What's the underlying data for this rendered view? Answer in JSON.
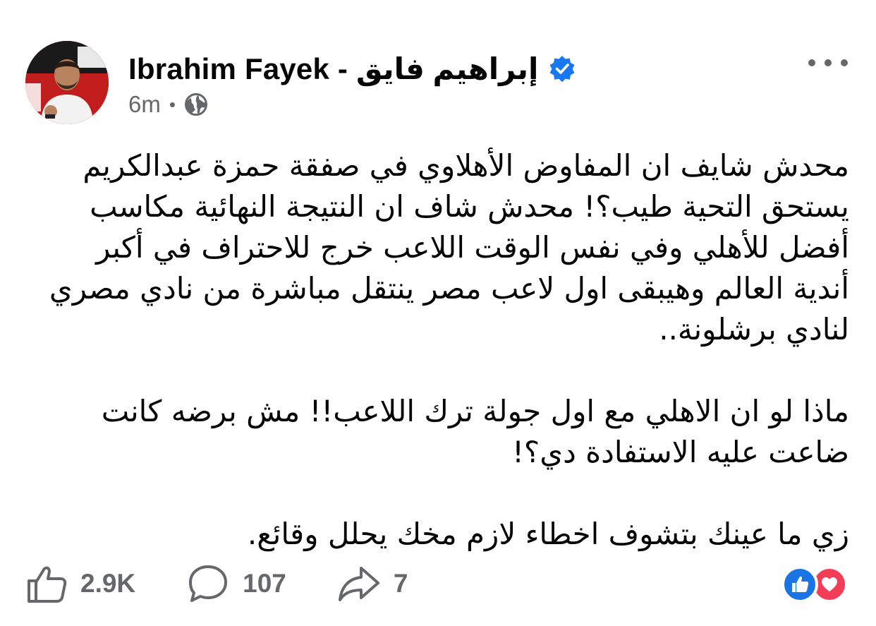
{
  "post": {
    "author": {
      "name": "Ibrahim Fayek - إبراهيم  فايق",
      "verified": true,
      "avatar_icon": "profile-photo"
    },
    "timestamp": "6m",
    "audience_icon": "globe-icon",
    "more_icon": "more-options-icon",
    "body": {
      "paragraphs": [
        "محدش شايف ان المفاوض الأهلاوي في صفقة حمزة عبدالكريم يستحق التحية طيب؟! محدش شاف ان النتيجة النهائية مكاسب أفضل للأهلي وفي نفس الوقت اللاعب خرج للاحتراف في أكبر أندية العالم وهيبقى اول لاعب مصر ينتقل مباشرة من نادي مصري لنادي برشلونة..",
        "ماذا لو ان الاهلي مع اول جولة ترك اللاعب!! مش برضه كانت ضاعت عليه الاستفادة دي؟!",
        "زي ما عينك بتشوف اخطاء لازم مخك يحلل وقائع."
      ]
    },
    "actions": {
      "like": {
        "icon": "thumbs-up-icon",
        "count": "2.9K"
      },
      "comment": {
        "icon": "comment-bubble-icon",
        "count": "107"
      },
      "share": {
        "icon": "share-arrow-icon",
        "count": "7"
      }
    },
    "reactions": [
      "like",
      "love"
    ]
  },
  "colors": {
    "verified_badge": "#1877f2",
    "secondary_text": "#65676b",
    "like_reaction": "#1b74e4",
    "love_reaction": "#f33e58"
  }
}
